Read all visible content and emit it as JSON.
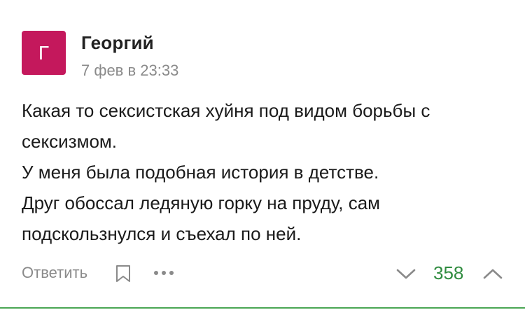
{
  "comment": {
    "avatar": {
      "letter": "Г",
      "color": "#c4185c"
    },
    "author": "Георгий",
    "timestamp": "7 фев в 23:33",
    "body_lines": [
      "Какая то сексистская хуйня под видом борьбы с",
      "сексизмом.",
      "У меня была подобная история в детстве.",
      "Друг обоссал ледяную горку на пруду, сам",
      "подскользнулся и съехал по ней."
    ],
    "actions": {
      "reply_label": "Ответить",
      "bookmark_icon": "bookmark-icon",
      "more_icon": "more-dots-icon"
    },
    "rating": {
      "value": "358",
      "color": "#2e8b3e",
      "down_icon": "chevron-down-icon",
      "up_icon": "chevron-up-icon"
    },
    "accent_line_color": "#4aa654"
  }
}
